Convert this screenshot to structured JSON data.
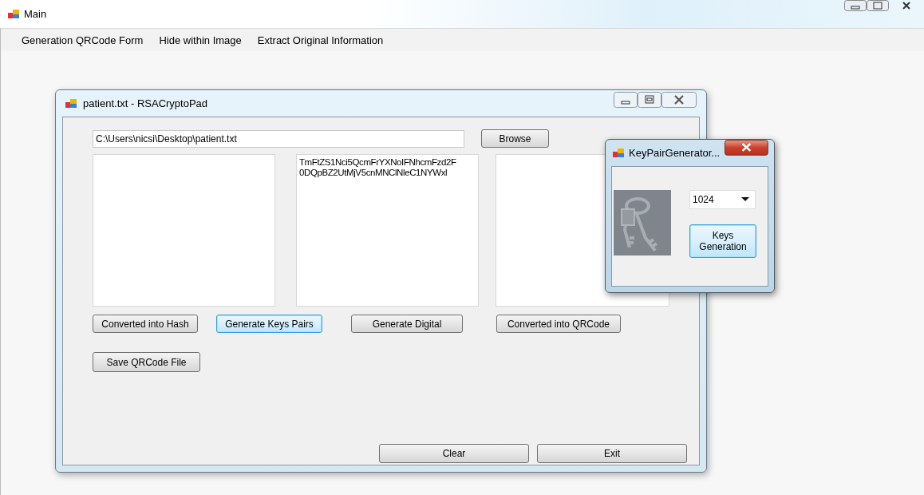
{
  "window": {
    "title": "Main"
  },
  "menu": [
    {
      "label": "Generation QRCode Form"
    },
    {
      "label": "Hide within Image"
    },
    {
      "label": "Extract Original Information"
    }
  ],
  "child_window": {
    "title": "patient.txt - RSACryptoPad",
    "path_field": {
      "value": "C:\\Users\\nicsi\\Desktop\\patient.txt"
    },
    "browse_button": {
      "label": "Browse",
      "focused": false
    },
    "middle_text_area": {
      "value": "TmFtZS1Nci5QcmFrYXNoIFNhcmFzd2F\n0DQpBZ2UtMjV5cnMNClNleC1NYWxl"
    },
    "action_buttons": [
      {
        "label": "Converted into Hash",
        "focused": false
      },
      {
        "label": "Generate Keys Pairs",
        "focused": true
      },
      {
        "label": "Generate Digital",
        "focused": false
      },
      {
        "label": "Converted into QRCode",
        "focused": false
      }
    ],
    "save_button": {
      "label": "Save QRCode File",
      "focused": false
    },
    "bottom_buttons": [
      {
        "label": "Clear",
        "focused": false
      },
      {
        "label": "Exit",
        "focused": false
      }
    ]
  },
  "dialog": {
    "title": "KeyPairGenerator...",
    "key_size": {
      "value": "1024"
    },
    "generate_button": {
      "label": "Keys\nGeneration",
      "focused": true
    }
  }
}
